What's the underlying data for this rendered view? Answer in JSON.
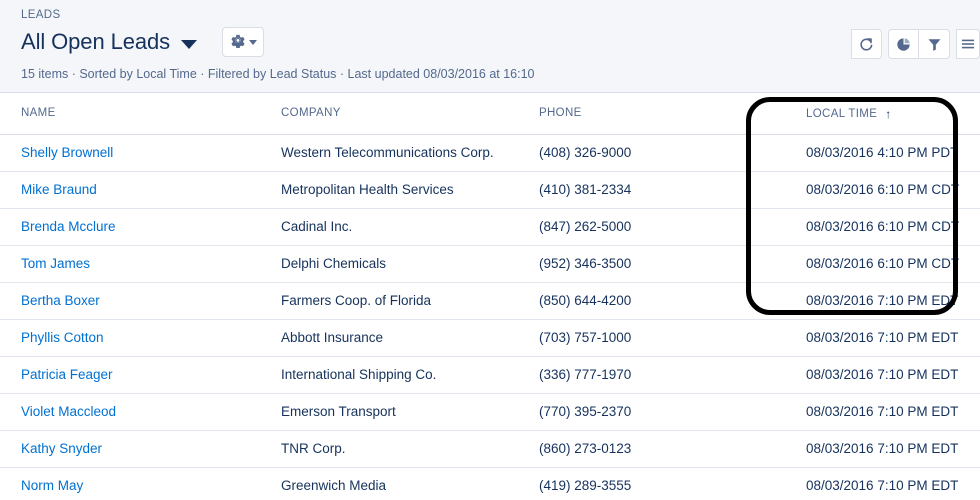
{
  "header": {
    "eyebrow": "LEADS",
    "title": "All Open Leads",
    "title_caret_icon": "chevron-down-icon",
    "gear_icon": "gear-icon",
    "gear_caret_icon": "chevron-down-icon",
    "meta": "15 items · Sorted by Local Time · Filtered by Lead Status · Last updated 08/03/2016 at 16:10",
    "actions": [
      {
        "name": "refresh-button",
        "icon": "refresh-icon"
      },
      {
        "name": "charts-button",
        "icon": "pie-chart-icon"
      },
      {
        "name": "filter-button",
        "icon": "filter-icon"
      },
      {
        "name": "display-options-button",
        "icon": "list-view-icon"
      }
    ]
  },
  "table": {
    "columns": [
      {
        "label": "NAME",
        "key": "name"
      },
      {
        "label": "COMPANY",
        "key": "company"
      },
      {
        "label": "PHONE",
        "key": "phone"
      },
      {
        "label": "LOCAL TIME",
        "key": "local_time"
      }
    ],
    "sort": {
      "column": "LOCAL TIME",
      "direction": "ascending",
      "arrow_glyph": "↑"
    },
    "rows": [
      {
        "name": "Shelly Brownell",
        "company": "Western Telecommunications Corp.",
        "phone": "(408) 326-9000",
        "local_time": "08/03/2016 4:10 PM PDT"
      },
      {
        "name": "Mike Braund",
        "company": "Metropolitan Health Services",
        "phone": "(410) 381-2334",
        "local_time": "08/03/2016 6:10 PM CDT"
      },
      {
        "name": "Brenda Mcclure",
        "company": "Cadinal Inc.",
        "phone": "(847) 262-5000",
        "local_time": "08/03/2016 6:10 PM CDT"
      },
      {
        "name": "Tom James",
        "company": "Delphi Chemicals",
        "phone": "(952) 346-3500",
        "local_time": "08/03/2016 6:10 PM CDT"
      },
      {
        "name": "Bertha Boxer",
        "company": "Farmers Coop. of Florida",
        "phone": "(850) 644-4200",
        "local_time": "08/03/2016 7:10 PM EDT"
      },
      {
        "name": "Phyllis Cotton",
        "company": "Abbott Insurance",
        "phone": "(703) 757-1000",
        "local_time": "08/03/2016 7:10 PM EDT"
      },
      {
        "name": "Patricia Feager",
        "company": "International Shipping Co.",
        "phone": "(336) 777-1970",
        "local_time": "08/03/2016 7:10 PM EDT"
      },
      {
        "name": "Violet Maccleod",
        "company": "Emerson Transport",
        "phone": "(770) 395-2370",
        "local_time": "08/03/2016 7:10 PM EDT"
      },
      {
        "name": "Kathy Snyder",
        "company": "TNR Corp.",
        "phone": "(860) 273-0123",
        "local_time": "08/03/2016 7:10 PM EDT"
      },
      {
        "name": "Norm May",
        "company": "Greenwich Media",
        "phone": "(419) 289-3555",
        "local_time": "08/03/2016 7:10 PM EDT"
      }
    ]
  },
  "annotation": {
    "name": "local-time-column-highlight",
    "shape": "oval",
    "color": "#000000"
  },
  "colors": {
    "link": "#0070d2",
    "text": "#16325c",
    "muted": "#54698d",
    "header_bg": "#f4f6f9",
    "border": "#d8dde6",
    "row_border": "#e0e5ee"
  }
}
